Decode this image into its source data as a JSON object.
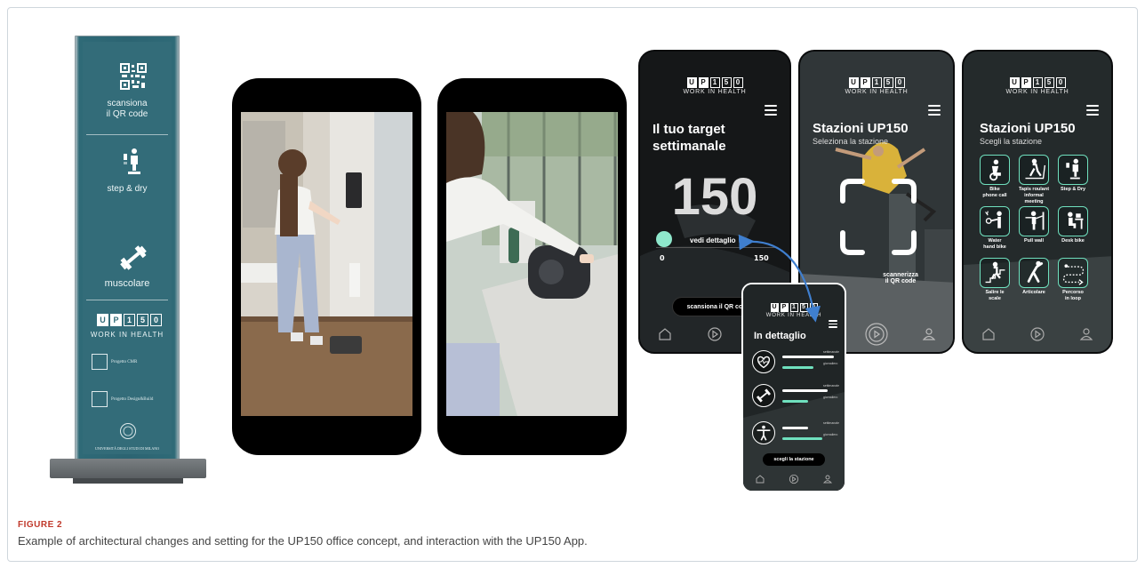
{
  "totem": {
    "qr_text": "scansiona\nil QR code",
    "step_label": "step & dry",
    "muscle_label": "muscolare",
    "brand_letters": [
      "U",
      "P",
      "1",
      "5",
      "0"
    ],
    "brand_sub": "WORK IN HEALTH",
    "sponsor1": "Progetto CMR",
    "sponsor2": "Progetto Design&Build",
    "university": "UNIVERSITÀ DEGLI STUDI DI MILANO"
  },
  "screen1": {
    "brand_letters": [
      "U",
      "P",
      "1",
      "5",
      "0"
    ],
    "brand_sub": "WORK IN HEALTH",
    "title": "Il tuo target\nsettimanale",
    "big_number": "150",
    "detail_link": "vedi dettaglio",
    "min_label": "0",
    "max_label": "150",
    "progress_fraction": 0,
    "scan_button": "scansiona il QR code"
  },
  "screen2": {
    "brand_letters": [
      "U",
      "P",
      "1",
      "5",
      "0"
    ],
    "brand_sub": "WORK IN HEALTH",
    "title": "Stazioni UP150",
    "subtitle": "Seleziona la stazione",
    "scan_text": "scannerizza\nil QR code"
  },
  "screen3": {
    "brand_letters": [
      "U",
      "P",
      "1",
      "5",
      "0"
    ],
    "brand_sub": "WORK IN HEALTH",
    "title": "Stazioni UP150",
    "subtitle": "Scegli la stazione",
    "stations": [
      {
        "label": "Bike\nphone call",
        "icon": "bike-icon"
      },
      {
        "label": "Tapis roulant\ninformal meeting",
        "icon": "treadmill-icon"
      },
      {
        "label": "Step & Dry",
        "icon": "step-icon"
      },
      {
        "label": "Water\nhand bike",
        "icon": "hand-bike-icon"
      },
      {
        "label": "Pull wall",
        "icon": "pull-wall-icon"
      },
      {
        "label": "Desk bike",
        "icon": "desk-bike-icon"
      },
      {
        "label": "Salire le\nscale",
        "icon": "stairs-icon"
      },
      {
        "label": "Articolare",
        "icon": "stretch-icon"
      },
      {
        "label": "Percorso\nin loop",
        "icon": "loop-icon"
      }
    ]
  },
  "screen4": {
    "brand_letters": [
      "U",
      "P",
      "1",
      "5",
      "0"
    ],
    "brand_sub": "WORK IN HEALTH",
    "title": "In dettaglio",
    "rows": [
      {
        "icon": "heart-icon",
        "weekly_label": "settimanale",
        "daily_label": "giornaliero",
        "weekly_fraction": 0.9,
        "daily_fraction": 0.55
      },
      {
        "icon": "muscle-icon",
        "weekly_label": "settimanale",
        "daily_label": "giornaliero",
        "weekly_fraction": 0.8,
        "daily_fraction": 0.45
      },
      {
        "icon": "stretch-person-icon",
        "weekly_label": "settimanale",
        "daily_label": "giornaliero",
        "weekly_fraction": 0.45,
        "daily_fraction": 0.7
      }
    ],
    "choose_button": "scegli la stazione"
  },
  "colors": {
    "accent": "#6fe0be",
    "totem": "#336c79",
    "arrow": "#3f7fcf",
    "caption_label": "#c0392b"
  },
  "caption": {
    "label": "FIGURE 2",
    "text": "Example of architectural changes and setting for the UP150 office concept, and interaction with the UP150 App."
  }
}
